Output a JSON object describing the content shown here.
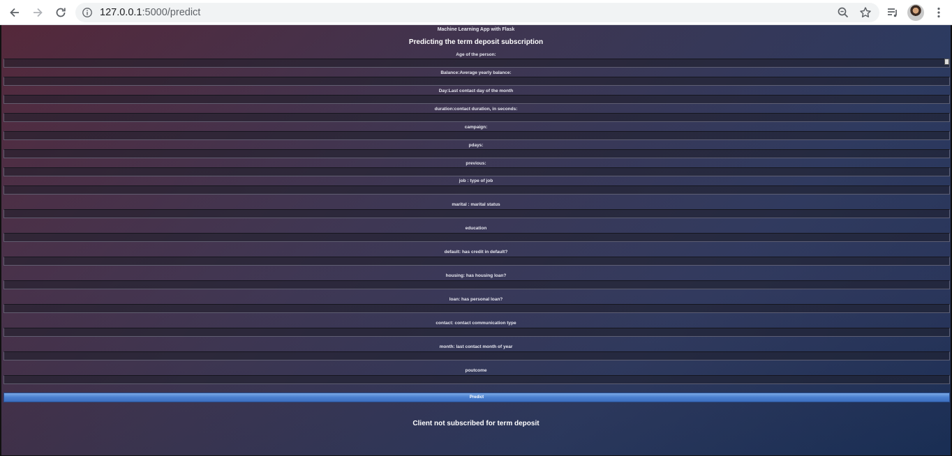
{
  "browser": {
    "url_host": "127.0.0.1",
    "url_path": ":5000/predict",
    "icons": [
      "back-arrow-icon",
      "forward-arrow-icon",
      "reload-icon",
      "info-icon",
      "zoom-icon",
      "star-icon",
      "media-queue-icon",
      "menu-dots-icon"
    ]
  },
  "page": {
    "app_title": "Machine Learning App with Flask",
    "main_title": "Predicting the term deposit subscription",
    "fields": [
      {
        "label": "Age of the person:",
        "value": ""
      },
      {
        "label": "Balance:Average yearly balance:",
        "value": ""
      },
      {
        "label": "Day:Last contact day of the month",
        "value": ""
      },
      {
        "label": "duration:contact duration, in seconds:",
        "value": ""
      },
      {
        "label": "campaign:",
        "value": ""
      },
      {
        "label": "pdays:",
        "value": ""
      },
      {
        "label": "previous:",
        "value": ""
      },
      {
        "label": "job : type of job",
        "value": ""
      },
      {
        "label": "marital : marital status",
        "value": ""
      },
      {
        "label": "education",
        "value": ""
      },
      {
        "label": "default: has credit in default?",
        "value": ""
      },
      {
        "label": "housing: has housing loan?",
        "value": ""
      },
      {
        "label": "loan: has personal loan?",
        "value": ""
      },
      {
        "label": "contact: contact communication type",
        "value": ""
      },
      {
        "label": "month: last contact month of year",
        "value": ""
      },
      {
        "label": "poutcome",
        "value": ""
      }
    ],
    "predict_label": "Predict",
    "result": "Client not subscribed for term deposit"
  },
  "colors": {
    "button": "#4a7fcf",
    "bg_left": "#55283a",
    "bg_right": "#1a3058"
  }
}
